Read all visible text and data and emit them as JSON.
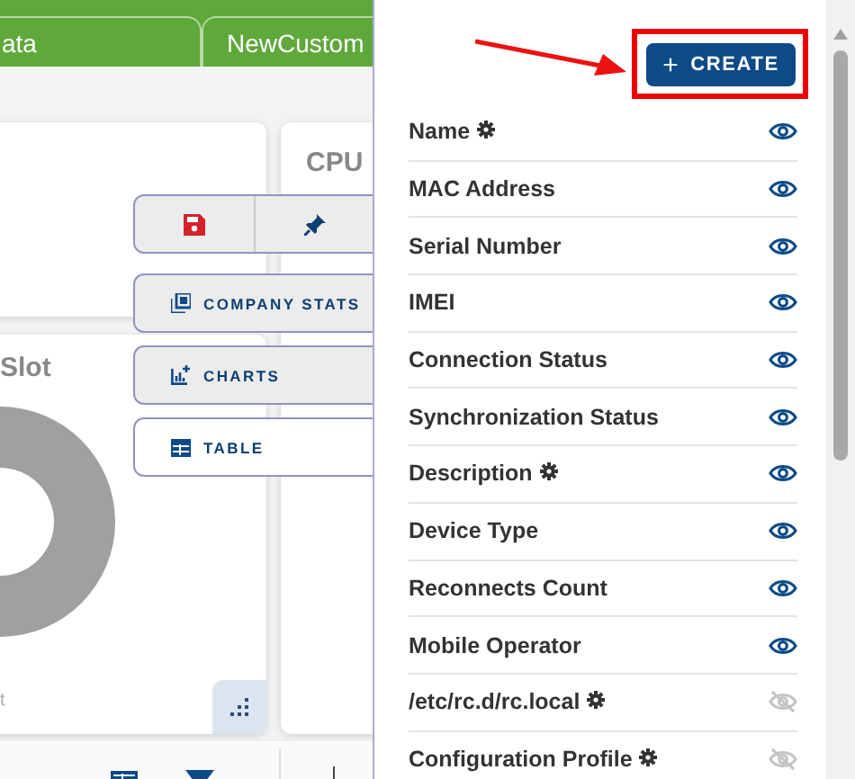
{
  "tabs": [
    {
      "label": "ata",
      "selected": false
    },
    {
      "label": "NewCustom",
      "selected": false
    }
  ],
  "cards": [
    {
      "title": "CPU"
    },
    {
      "title": "Slot",
      "legend": "t"
    }
  ],
  "actions": [
    {
      "kind": "icons"
    },
    {
      "kind": "text",
      "label": "COMPANY STATS",
      "selected": false
    },
    {
      "kind": "text",
      "label": "CHARTS",
      "selected": false
    },
    {
      "kind": "text",
      "label": "TABLE",
      "selected": true
    }
  ],
  "drawer": {
    "create_button": "CREATE",
    "create_icon": "+",
    "columns": [
      {
        "label": "Name",
        "settings": true,
        "visible": true
      },
      {
        "label": "MAC Address",
        "settings": false,
        "visible": true
      },
      {
        "label": "Serial Number",
        "settings": false,
        "visible": true
      },
      {
        "label": "IMEI",
        "settings": false,
        "visible": true
      },
      {
        "label": "Connection Status",
        "settings": false,
        "visible": true
      },
      {
        "label": "Synchronization Status",
        "settings": false,
        "visible": true
      },
      {
        "label": "Description",
        "settings": true,
        "visible": true
      },
      {
        "label": "Device Type",
        "settings": false,
        "visible": true
      },
      {
        "label": "Reconnects Count",
        "settings": false,
        "visible": true
      },
      {
        "label": "Mobile Operator",
        "settings": false,
        "visible": true
      },
      {
        "label": "/etc/rc.d/rc.local",
        "settings": true,
        "visible": false
      },
      {
        "label": "Configuration Profile",
        "settings": true,
        "visible": false
      }
    ]
  }
}
